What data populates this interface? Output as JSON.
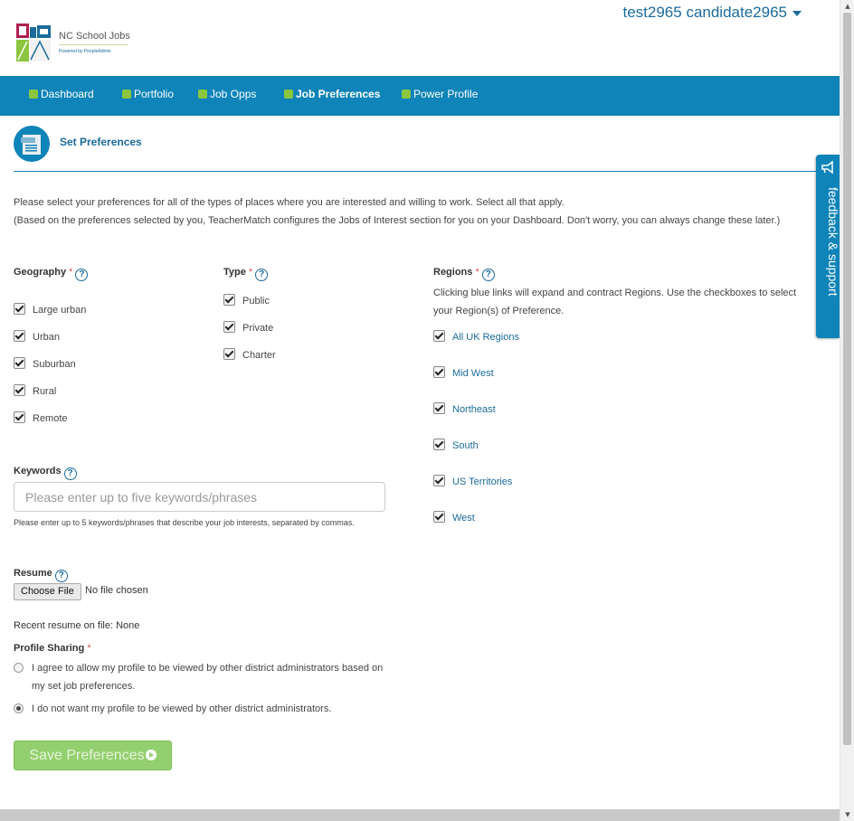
{
  "header": {
    "user_name": "test2965 candidate2965",
    "logo_title": "NC School Jobs",
    "logo_sub": "Powered by PeopleAdmin"
  },
  "nav": {
    "items": [
      {
        "label": "Dashboard"
      },
      {
        "label": "Portfolio"
      },
      {
        "label": "Job Opps"
      },
      {
        "label": "Job Preferences"
      },
      {
        "label": "Power Profile"
      }
    ],
    "active": "Job Preferences"
  },
  "feedback_label": "feedback & support",
  "section": {
    "title": "Set Preferences",
    "intro_line1": "Please select your preferences for all of the types of places where you are interested and willing to work. Select all that apply.",
    "intro_line2": "(Based on the preferences selected by you, TeacherMatch configures the Jobs of Interest section for you on your Dashboard. Don't worry, you can always change these later.)"
  },
  "geography": {
    "label": "Geography",
    "options": [
      {
        "label": "Large urban",
        "checked": true
      },
      {
        "label": "Urban",
        "checked": true
      },
      {
        "label": "Suburban",
        "checked": true
      },
      {
        "label": "Rural",
        "checked": true
      },
      {
        "label": "Remote",
        "checked": true
      }
    ]
  },
  "type": {
    "label": "Type",
    "options": [
      {
        "label": "Public",
        "checked": true
      },
      {
        "label": "Private",
        "checked": true
      },
      {
        "label": "Charter",
        "checked": true
      }
    ]
  },
  "regions": {
    "label": "Regions",
    "note": "Clicking blue links will expand and contract Regions. Use the checkboxes to select your Region(s) of Preference.",
    "options": [
      {
        "label": "All UK Regions",
        "checked": true
      },
      {
        "label": "Mid West",
        "checked": true
      },
      {
        "label": "Northeast",
        "checked": true
      },
      {
        "label": "South",
        "checked": true
      },
      {
        "label": "US Territories",
        "checked": true
      },
      {
        "label": "West",
        "checked": true
      }
    ]
  },
  "keywords": {
    "label": "Keywords",
    "placeholder": "Please enter up to five keywords/phrases",
    "value": "",
    "note": "Please enter up to 5 keywords/phrases that describe your job interests, separated by commas."
  },
  "resume": {
    "label": "Resume",
    "button": "Choose File",
    "status": "No file chosen",
    "recent": "Recent resume on file: None"
  },
  "profile_sharing": {
    "label": "Profile Sharing",
    "options": [
      {
        "label": "I agree to allow my profile to be viewed by other district administrators based on my set job preferences.",
        "selected": false
      },
      {
        "label": "I do not want my profile to be viewed by other district administrators.",
        "selected": true
      }
    ]
  },
  "save_button": "Save Preferences",
  "required_mark": "*",
  "help_glyph": "?",
  "colors": {
    "primary": "#0f84b8",
    "nav_square": "#8cc63f",
    "save_button": "#93cf6e",
    "required": "#d9534f"
  }
}
